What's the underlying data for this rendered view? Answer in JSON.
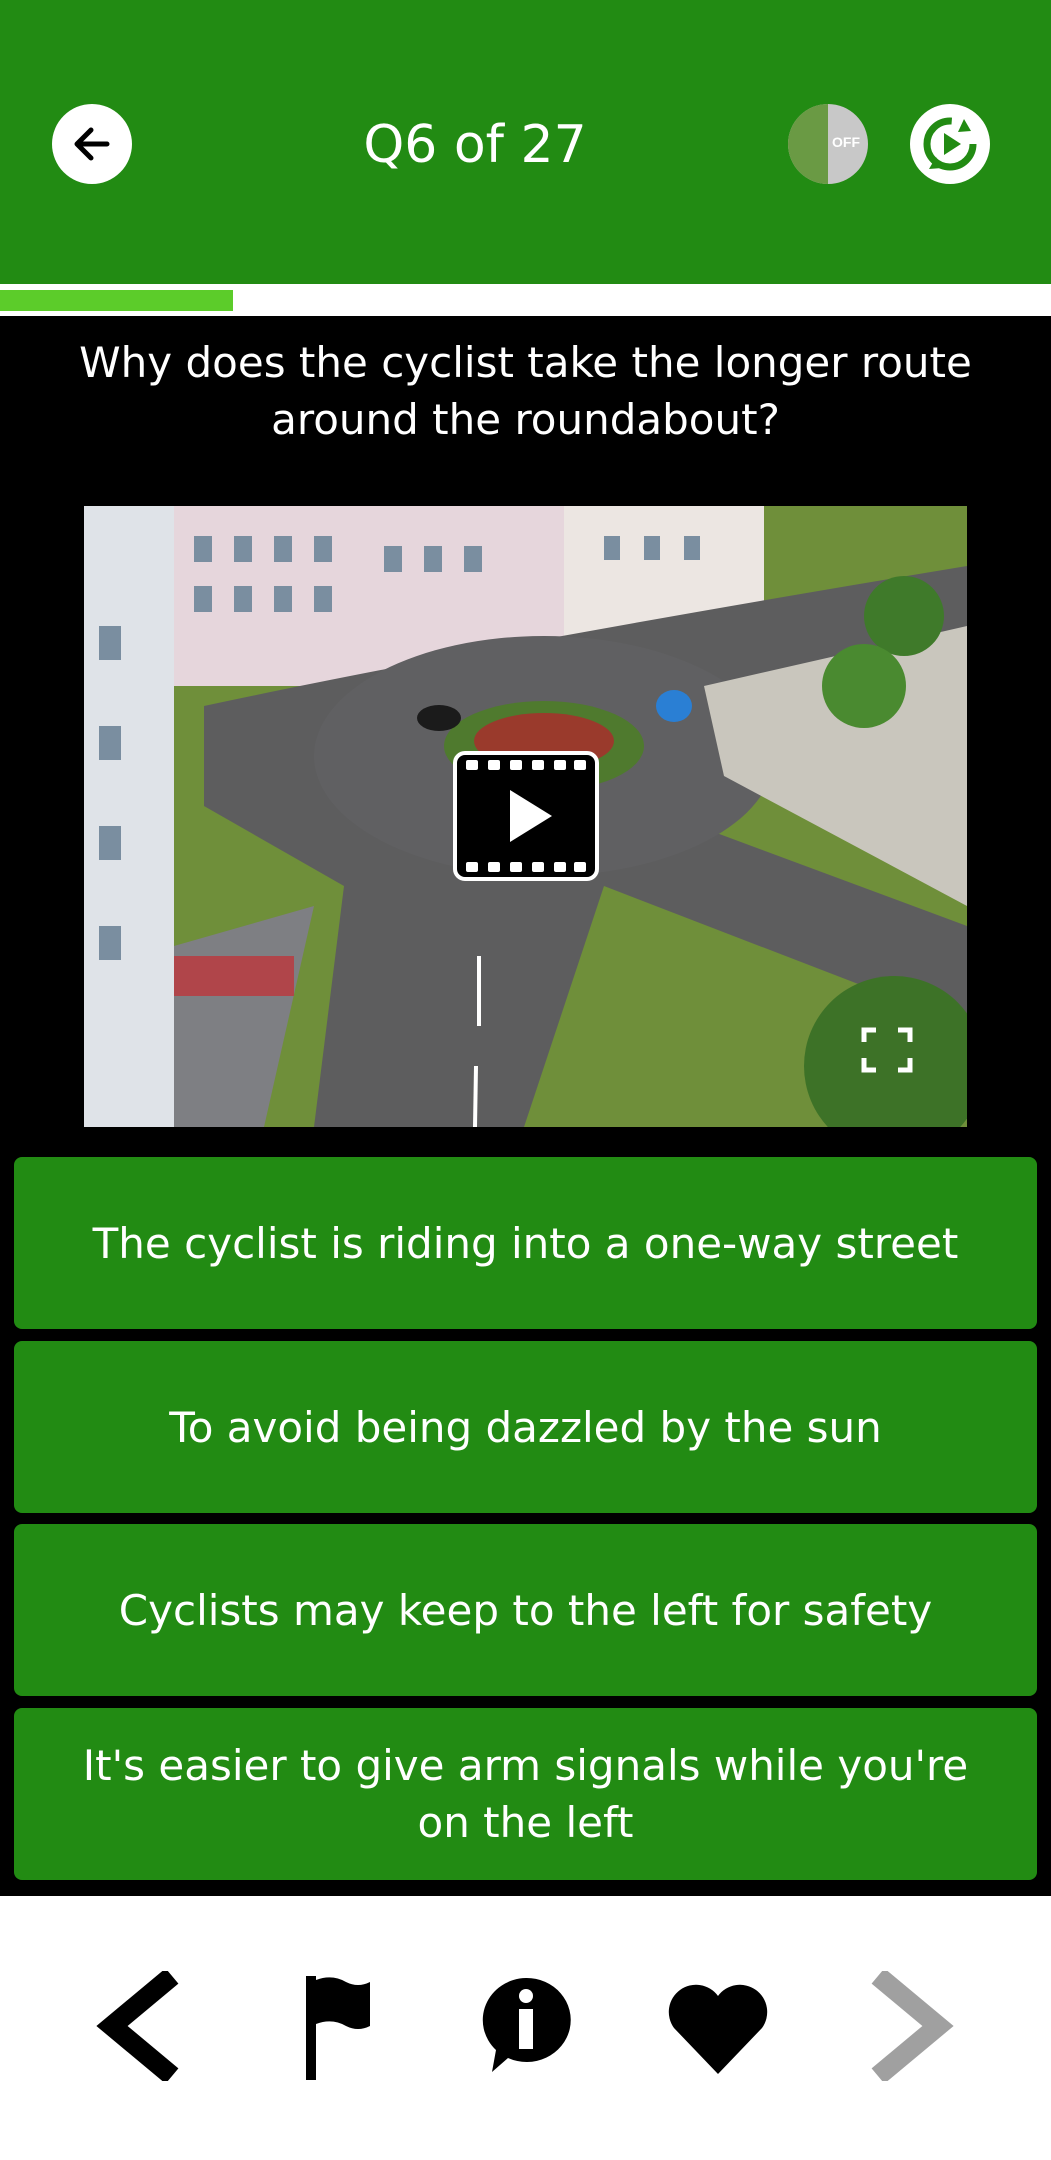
{
  "header": {
    "title": "Q6 of 27",
    "back_icon": "arrow-left-icon",
    "voice_toggle": {
      "icon": "voice-head-icon",
      "state_label": "OFF"
    },
    "refresh_icon": "refresh-play-icon"
  },
  "progress": {
    "current": 6,
    "total": 27,
    "fraction": 0.222
  },
  "question": {
    "text": "Why does the cyclist take the longer route around the roundabout?"
  },
  "video": {
    "play_icon": "video-play-icon",
    "fullscreen_icon": "fullscreen-icon"
  },
  "answers": [
    {
      "label": "The cyclist is riding into a one-way street"
    },
    {
      "label": "To avoid being dazzled by the sun"
    },
    {
      "label": "Cyclists may keep to the left for safety"
    },
    {
      "label": "It's easier to give arm signals while you're on the left"
    }
  ],
  "bottom_nav": {
    "items": [
      {
        "icon": "chevron-left-icon"
      },
      {
        "icon": "flag-icon"
      },
      {
        "icon": "info-icon"
      },
      {
        "icon": "heart-icon"
      },
      {
        "icon": "chevron-right-icon",
        "disabled": true
      }
    ]
  },
  "colors": {
    "header_green": "#228b13",
    "answer_green": "#228b13",
    "progress_green": "#5ccc2a",
    "background_black": "#000000",
    "disabled_gray": "#a0a0a0"
  }
}
